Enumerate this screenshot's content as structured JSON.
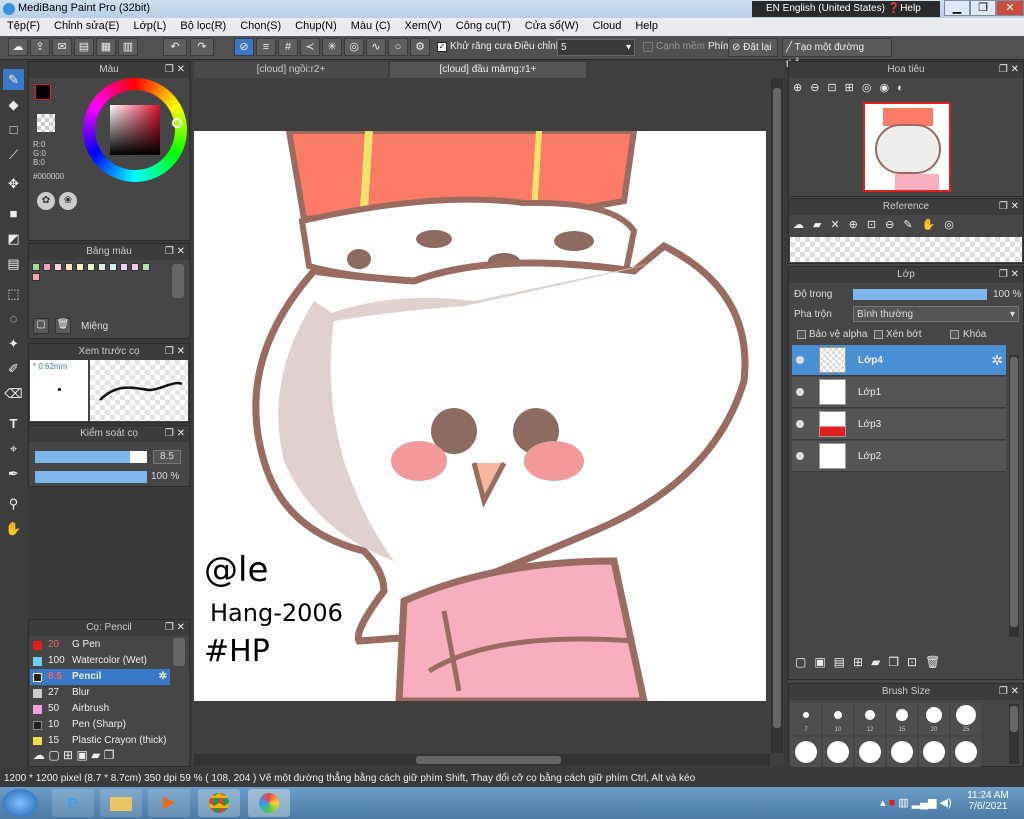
{
  "window": {
    "title": "MediBang Paint Pro (32bit)",
    "language": "EN English (United States)",
    "help": "Help"
  },
  "menu": [
    "Tệp(F)",
    "Chỉnh sửa(E)",
    "Lớp(L)",
    "Bộ lọc(R)",
    "Chọn(S)",
    "Chụp(N)",
    "Màu (C)",
    "Xem(V)",
    "Công cụ(T)",
    "Cửa sổ(W)",
    "Cloud",
    "Help"
  ],
  "toolbar": {
    "antialias": "Khử răng cưa",
    "correction_label": "Điều chỉnh",
    "correction_value": "5",
    "soft_edge": "Cạnh mềm",
    "key_label": "Phím",
    "reset": "Đặt lại",
    "straight_line": "Tạo một đường thẳng"
  },
  "color_panel": {
    "title": "Màu",
    "r": "R:0",
    "g": "G:0",
    "b": "B:0",
    "hex": "#000000",
    "primary": "#000000",
    "secondary": "#ffffff"
  },
  "palette_panel": {
    "title": "Bảng màu",
    "swatches": [
      "#9be18a",
      "#f4a0b4",
      "#ffd1dc",
      "#fbe0c4",
      "#fff5c2",
      "#e8f4c8",
      "#d8f0e8",
      "#d4eef8",
      "#e2d7f5",
      "#f1c9ec",
      "#b5e0a8",
      "#f2a7b4"
    ],
    "name": "Miệng"
  },
  "preview_panel": {
    "title": "Xem trước cọ",
    "size": "* 0.62mm"
  },
  "brush_control": {
    "title": "Kiểm soát cọ",
    "size": "8.5",
    "opacity": "100 %",
    "size_fraction": 0.85,
    "opacity_fraction": 1.0
  },
  "brush_list": {
    "title": "Cọ: Pencil",
    "items": [
      {
        "color": "#e02020",
        "size": "20",
        "name": "G Pen"
      },
      {
        "color": "#70d0f0",
        "size": "100",
        "name": "Watercolor (Wet)"
      },
      {
        "color": "#222222",
        "size": "8.5",
        "name": "Pencil"
      },
      {
        "color": "#cccccc",
        "size": "27",
        "name": "Blur"
      },
      {
        "color": "#f0a0e0",
        "size": "50",
        "name": "Airbrush"
      },
      {
        "color": "#222222",
        "size": "10",
        "name": "Pen (Sharp)"
      },
      {
        "color": "#f0e040",
        "size": "15",
        "name": "Plastic Crayon (thick)"
      }
    ]
  },
  "tabs": [
    "[cloud] ngồi:r2+",
    "[cloud] đầu mâmg:r1+"
  ],
  "canvas": {
    "handwriting": [
      "@le",
      "Hang-2006",
      "#HP"
    ]
  },
  "navigator": {
    "title": "Hoa tiêu"
  },
  "reference": {
    "title": "Reference"
  },
  "layers_panel": {
    "title": "Lớp",
    "opacity_label": "Độ trong",
    "opacity_value": "100 %",
    "blend_label": "Pha trộn",
    "blend_value": "Bình thường",
    "protect_alpha": "Bảo vệ alpha",
    "clipping": "Xén bớt",
    "lock": "Khóa",
    "layers": [
      "Lớp4",
      "Lớp1",
      "Lớp3",
      "Lớp2"
    ]
  },
  "brush_size_panel": {
    "title": "Brush Size",
    "sizes": [
      "7",
      "10",
      "12",
      "15",
      "20",
      "25"
    ]
  },
  "status": "1200 * 1200 pixel   (8.7 * 8.7cm)   350 dpi   59 %   ( 108, 204 )   Vẽ một đường thẳng bằng cách giữ phím Shift, Thay đổi cỡ cọ bằng cách giữ phím Ctrl, Alt và kéo",
  "clock": {
    "time": "11:24 AM",
    "date": "7/6/2021"
  }
}
